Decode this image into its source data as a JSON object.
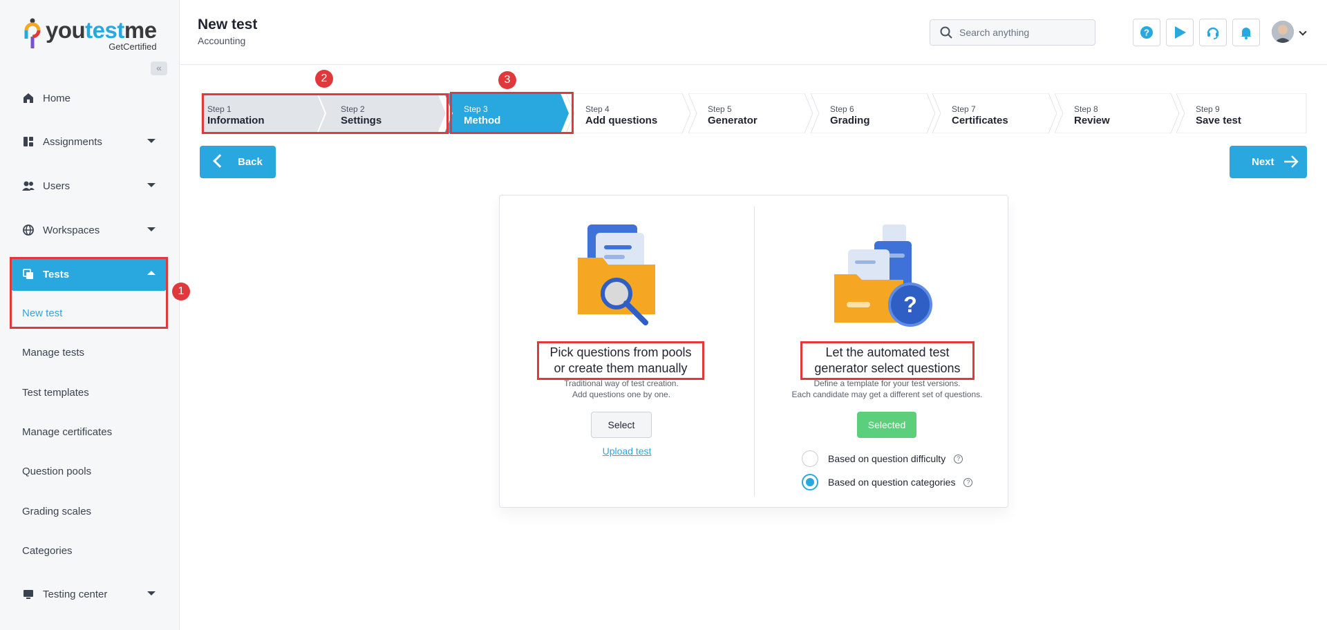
{
  "app": {
    "logo_you": "you",
    "logo_test": "test",
    "logo_me": "me",
    "logo_sub": "GetCertified"
  },
  "sidebar": {
    "collapse_icon": "double-chevron-left-icon",
    "items": [
      {
        "label": "Home",
        "icon": "home-icon"
      },
      {
        "label": "Assignments",
        "icon": "assignments-icon"
      },
      {
        "label": "Users",
        "icon": "users-icon"
      },
      {
        "label": "Workspaces",
        "icon": "globe-icon"
      },
      {
        "label": "Tests",
        "icon": "tests-icon"
      },
      {
        "label": "Testing center",
        "icon": "monitor-icon"
      }
    ],
    "sub_items": [
      "New test",
      "Manage tests",
      "Test templates",
      "Manage certificates",
      "Question pools",
      "Grading scales",
      "Categories"
    ]
  },
  "header": {
    "title": "New test",
    "subtitle": "Accounting",
    "search_placeholder": "Search anything"
  },
  "annotations": {
    "badge1": "1",
    "badge2": "2",
    "badge3": "3"
  },
  "steps": [
    {
      "step": "Step 1",
      "name": "Information"
    },
    {
      "step": "Step 2",
      "name": "Settings"
    },
    {
      "step": "Step 3",
      "name": "Method"
    },
    {
      "step": "Step 4",
      "name": "Add questions"
    },
    {
      "step": "Step 5",
      "name": "Generator"
    },
    {
      "step": "Step 6",
      "name": "Grading"
    },
    {
      "step": "Step 7",
      "name": "Certificates"
    },
    {
      "step": "Step 8",
      "name": "Review"
    },
    {
      "step": "Step 9",
      "name": "Save test"
    }
  ],
  "nav": {
    "back_label": "Back",
    "next_label": "Next"
  },
  "options": {
    "manual": {
      "title_line1": "Pick questions from pools",
      "title_line2": "or create them manually",
      "desc_line1": "Traditional way of test creation.",
      "desc_line2": "Add questions one by one.",
      "button": "Select",
      "link": "Upload test"
    },
    "auto": {
      "title_line1": "Let the automated test",
      "title_line2": "generator select questions",
      "desc_line1": "Define a template for your test versions.",
      "desc_line2": "Each candidate may get a different set of questions.",
      "button": "Selected",
      "radio1": "Based on question difficulty",
      "radio2": "Based on question categories",
      "selected_radio": "Based on question categories"
    }
  },
  "colors": {
    "accent": "#29a8e0",
    "highlight": "#e0393b",
    "success": "#5ccf7c"
  }
}
